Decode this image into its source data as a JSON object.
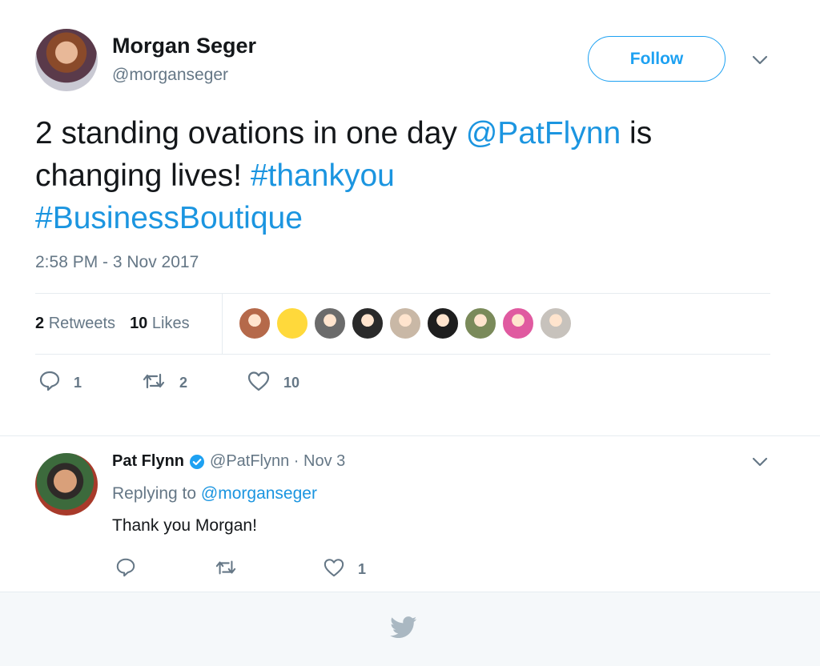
{
  "tweet": {
    "author_name": "Morgan Seger",
    "author_handle": "@morganseger",
    "follow_label": "Follow",
    "text_parts": [
      {
        "text": "2 standing ovations in one day ",
        "type": "plain"
      },
      {
        "text": "@PatFlynn",
        "type": "link"
      },
      {
        "text": " is changing lives! ",
        "type": "plain"
      },
      {
        "text": "#thankyou",
        "type": "link"
      },
      {
        "text": " ",
        "type": "plain"
      },
      {
        "text": "#BusinessBoutique",
        "type": "link"
      }
    ],
    "timestamp": "2:58 PM - 3 Nov 2017",
    "stats": {
      "retweets_count": "2",
      "retweets_label": "Retweets",
      "likes_count": "10",
      "likes_label": "Likes"
    },
    "likers_colors": [
      "#b5694a",
      "#ffd93b",
      "#6b6b6b",
      "#2a2a2a",
      "#c9b8a6",
      "#1e1e1e",
      "#7a8a5a",
      "#e05aa0",
      "#c7c2bc"
    ],
    "actions": {
      "reply_count": "1",
      "retweet_count": "2",
      "like_count": "10"
    }
  },
  "reply": {
    "author_name": "Pat Flynn",
    "author_handle": "@PatFlynn",
    "separator": " · ",
    "date": "Nov 3",
    "replying_prefix": "Replying to ",
    "replying_to": "@morganseger",
    "text": "Thank you Morgan!",
    "actions": {
      "like_count": "1"
    }
  },
  "colors": {
    "accent": "#1da1f2",
    "link": "#1b95e0",
    "muted": "#657786"
  }
}
